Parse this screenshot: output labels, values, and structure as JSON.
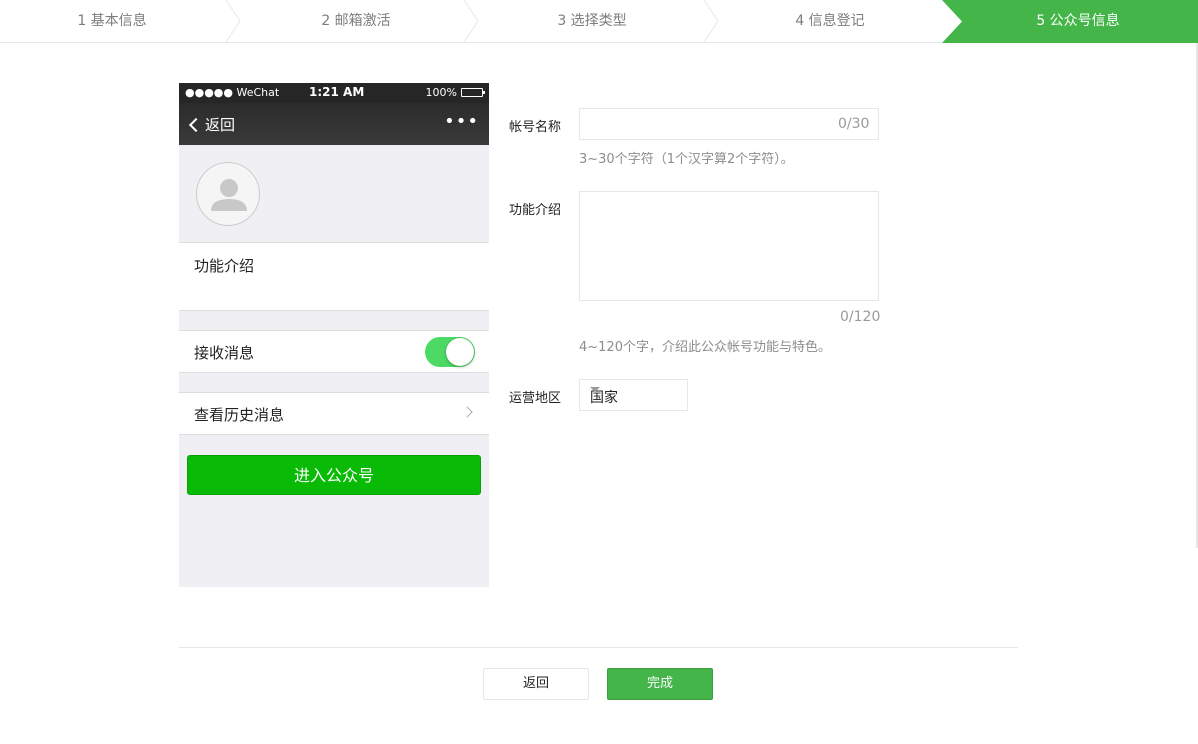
{
  "stepper": {
    "steps": [
      {
        "label": "1 基本信息",
        "active": false
      },
      {
        "label": "2 邮箱激活",
        "active": false
      },
      {
        "label": "3 选择类型",
        "active": false
      },
      {
        "label": "4 信息登记",
        "active": false
      },
      {
        "label": "5 公众号信息",
        "active": true
      }
    ],
    "active_color": "#44b549"
  },
  "phone": {
    "status": {
      "carrier": "●●●●● WeChat",
      "time": "1:21 AM",
      "battery": "100%"
    },
    "nav": {
      "back_label": "返回",
      "more_label": "•••"
    },
    "intro_label": "功能介绍",
    "receive_label": "接收消息",
    "receive_on": true,
    "history_label": "查看历史消息",
    "enter_label": "进入公众号",
    "enter_color": "#09bb07"
  },
  "form": {
    "name_label": "帐号名称",
    "name_value": "",
    "name_counter": "0/30",
    "name_hint": "3~30个字符（1个汉字算2个字符）。",
    "intro_label": "功能介绍",
    "intro_value": "",
    "intro_counter": "0/120",
    "intro_hint": "4~120个字，介绍此公众帐号功能与特色。",
    "region_label": "运营地区",
    "region_value": "国家"
  },
  "footer": {
    "back_label": "返回",
    "done_label": "完成"
  }
}
